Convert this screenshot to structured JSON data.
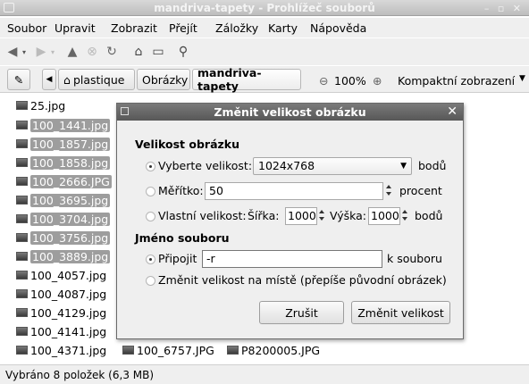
{
  "window": {
    "title": "mandriva-tapety - Prohlížeč souborů"
  },
  "menubar": {
    "items": [
      {
        "label": "Soubor"
      },
      {
        "label": "Upravit"
      },
      {
        "label": "Zobrazit"
      },
      {
        "label": "Přejít"
      },
      {
        "label": "Záložky"
      },
      {
        "label": "Karty"
      },
      {
        "label": "Nápověda"
      }
    ]
  },
  "toolbar": {
    "icons": [
      "back-icon",
      "forward-icon",
      "up-icon",
      "stop-icon",
      "reload-icon",
      "home-icon",
      "computer-icon",
      "search-icon"
    ]
  },
  "pathbar": {
    "crumbs": [
      "plastique",
      "Obrázky",
      "mandriva-tapety"
    ],
    "zoom": "100%",
    "view_mode": "Kompaktní zobrazení"
  },
  "files": {
    "col1": [
      {
        "name": "25.jpg",
        "selected": false
      },
      {
        "name": "100_1441.jpg",
        "selected": true
      },
      {
        "name": "100_1857.jpg",
        "selected": true
      },
      {
        "name": "100_1858.jpg",
        "selected": true
      },
      {
        "name": "100_2666.JPG",
        "selected": true
      },
      {
        "name": "100_3695.jpg",
        "selected": true
      },
      {
        "name": "100_3704.jpg",
        "selected": true
      },
      {
        "name": "100_3756.jpg",
        "selected": true
      },
      {
        "name": "100_3889.jpg",
        "selected": true
      },
      {
        "name": "100_4057.jpg",
        "selected": false
      },
      {
        "name": "100_4087.jpg",
        "selected": false
      },
      {
        "name": "100_4129.jpg",
        "selected": false
      },
      {
        "name": "100_4141.jpg",
        "selected": false
      },
      {
        "name": "100_4371.jpg",
        "selected": false
      }
    ],
    "col2_last": "100_6757.JPG",
    "col3_last": "P8200005.JPG"
  },
  "statusbar": {
    "text": "Vybráno 8 položek (6,3 MB)"
  },
  "dialog": {
    "title": "Změnit velikost obrázku",
    "section_size": "Velikost obrázku",
    "opt_select_label": "Vyberte velikost:",
    "opt_select_value": "1024x768",
    "opt_select_unit": "bodů",
    "opt_scale_label": "Měřítko:",
    "opt_scale_value": "50",
    "opt_scale_unit": "procent",
    "opt_custom_label": "Vlastní velikost:",
    "width_label": "Šířka:",
    "width_value": "1000",
    "height_label": "Výška:",
    "height_value": "1000",
    "custom_unit": "bodů",
    "section_filename": "Jméno souboru",
    "opt_append_label": "Připojit",
    "opt_append_value": "-r",
    "opt_append_suffix": "k souboru",
    "opt_inplace_label": "Změnit velikost na místě (přepíše původní obrázek)",
    "cancel_label": "Zrušit",
    "ok_label": "Změnit velikost"
  }
}
